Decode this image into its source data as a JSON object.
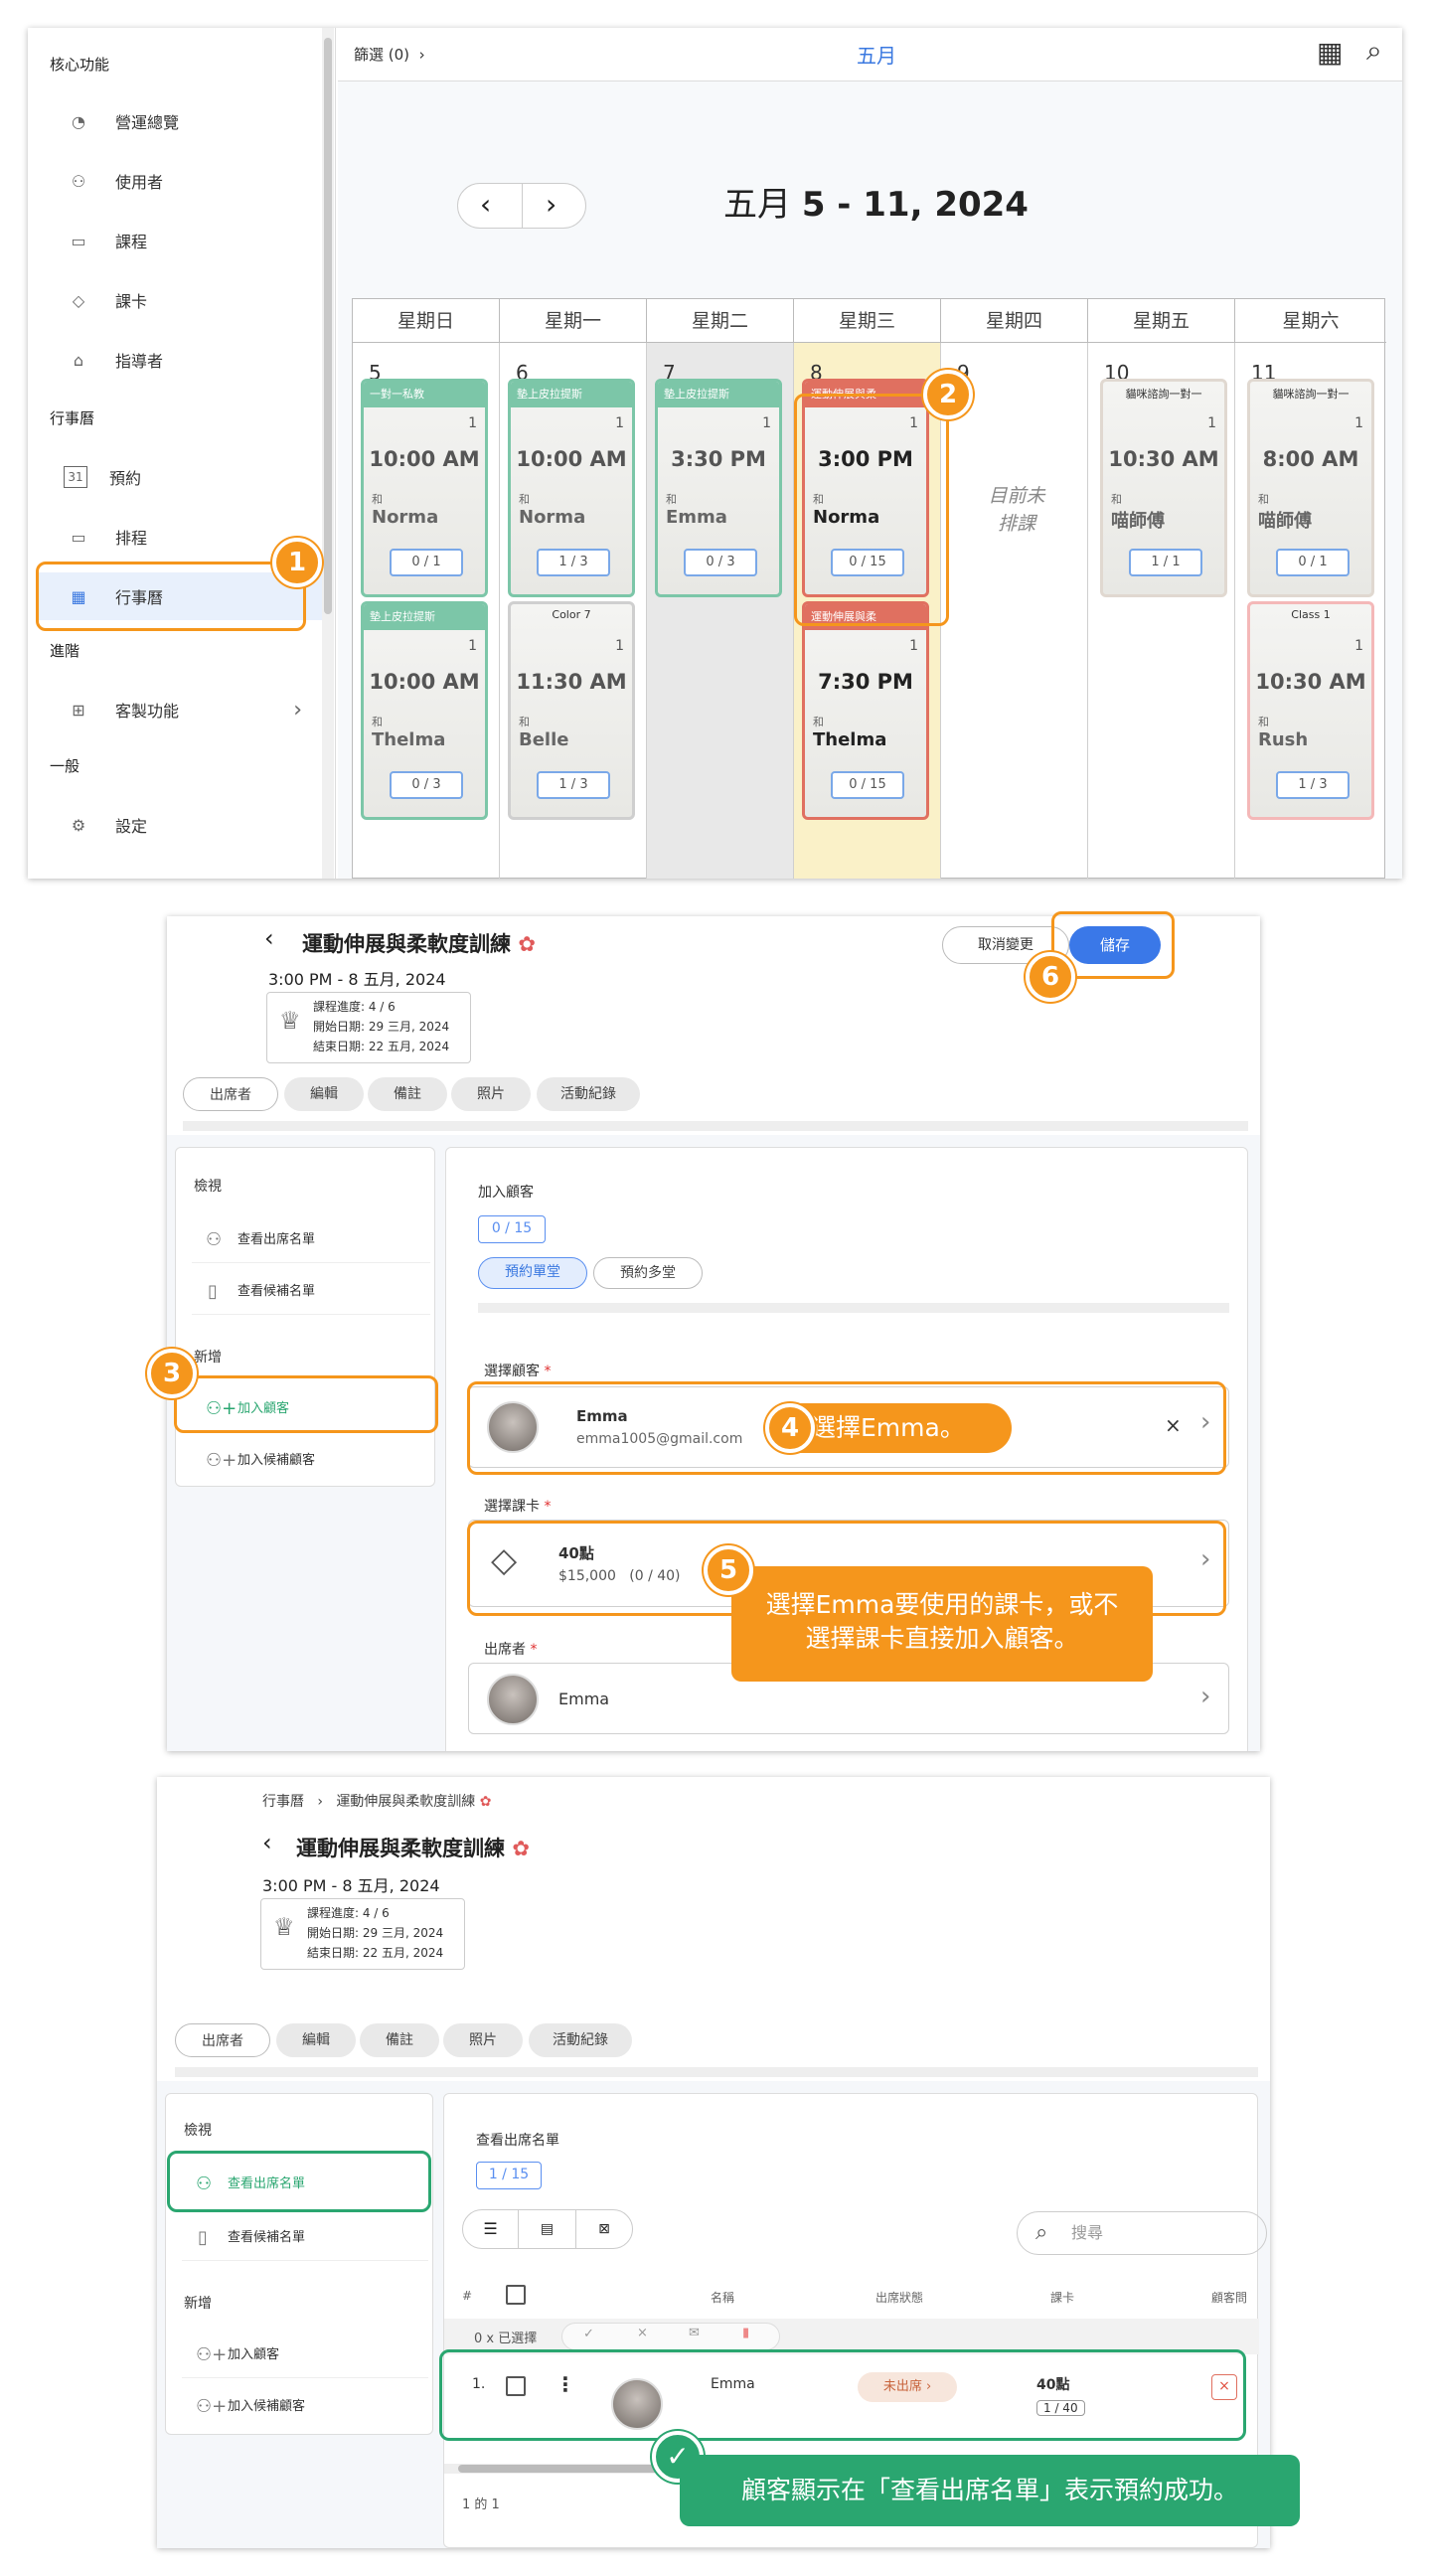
{
  "calendar": {
    "filter": "篩選 (0)",
    "month": "五月",
    "range_prefix": "五月 ",
    "range_bold": "5 - 11, 2024",
    "days": [
      "星期日",
      "星期一",
      "星期二",
      "星期三",
      "星期四",
      "星期五",
      "星期六"
    ],
    "dates": [
      "5",
      "6",
      "7",
      "8",
      "9",
      "10",
      "11"
    ],
    "no_class": "目前未排課",
    "cards": [
      {
        "title": "一對一私教",
        "cap": "1",
        "time": "10:00 AM",
        "with": "和",
        "teacher": "Norma",
        "spots": "0 / 1",
        "color": "#7cc6a8"
      },
      {
        "title": "墊上皮拉提斯",
        "cap": "1",
        "time": "10:00 AM",
        "with": "和",
        "teacher": "Norma",
        "spots": "1 / 3",
        "color": "#7cc6a8"
      },
      {
        "title": "墊上皮拉提斯",
        "cap": "1",
        "time": "3:30 PM",
        "with": "和",
        "teacher": "Emma",
        "spots": "0 / 3",
        "color": "#7cc6a8"
      },
      {
        "title": "運動伸展與柔",
        "cap": "1",
        "time": "3:00 PM",
        "with": "和",
        "teacher": "Norma",
        "spots": "0 / 15",
        "color": "#e07060"
      },
      {
        "title": "貓咪諮詢一對一",
        "cap": "1",
        "time": "10:30 AM",
        "with": "和",
        "teacher": "喵師傅",
        "spots": "1 / 1",
        "color": "#e0d8d0"
      },
      {
        "title": "貓咪諮詢一對一",
        "cap": "1",
        "time": "8:00 AM",
        "with": "和",
        "teacher": "喵師傅",
        "spots": "0 / 1",
        "color": "#e0d8d0"
      },
      {
        "title": "墊上皮拉提斯",
        "cap": "1",
        "time": "10:00 AM",
        "with": "和",
        "teacher": "Thelma",
        "spots": "0 / 3",
        "color": "#7cc6a8"
      },
      {
        "title": "Color 7",
        "cap": "1",
        "time": "11:30 AM",
        "with": "和",
        "teacher": "Belle",
        "spots": "1 / 3",
        "color": "#e5e5e5"
      },
      {
        "title": "運動伸展與柔",
        "cap": "1",
        "time": "7:30 PM",
        "with": "和",
        "teacher": "Thelma",
        "spots": "0 / 15",
        "color": "#e07060"
      },
      {
        "title": "Class 1",
        "cap": "1",
        "time": "10:30 AM",
        "with": "和",
        "teacher": "Rush",
        "spots": "1 / 3",
        "color": "#f4b8b8"
      }
    ]
  },
  "sidebar": {
    "cat1": "核心功能",
    "items1": [
      "營運總覽",
      "使用者",
      "課程",
      "課卡",
      "指導者"
    ],
    "cat2": "行事曆",
    "items2": [
      "預約",
      "排程",
      "行事曆"
    ],
    "cat3": "進階",
    "items3": [
      "客製功能"
    ],
    "cat4": "一般",
    "items4": [
      "設定"
    ]
  },
  "steps": [
    "1",
    "2",
    "3",
    "4",
    "5",
    "6"
  ],
  "detail": {
    "title": "運動伸展與柔軟度訓練",
    "datetime": "3:00 PM - 8 五月, 2024",
    "progress": "課程進度: 4 / 6",
    "start": "開始日期: 29 三月, 2024",
    "end": "結束日期: 22 五月, 2024",
    "tabs": [
      "出席者",
      "編輯",
      "備註",
      "照片",
      "活動紀錄"
    ],
    "cancel": "取消變更",
    "save": "儲存",
    "view_head": "檢視",
    "view_items": [
      "查看出席名單",
      "查看候補名單"
    ],
    "new_head": "新增",
    "new_items": [
      "加入顧客",
      "加入候補顧客"
    ],
    "add_customer": "加入顧客",
    "count": "0 / 15",
    "book_single": "預約單堂",
    "book_multi": "預約多堂",
    "select_customer": "選擇顧客",
    "customer_name": "Emma",
    "customer_email": "emma1005@gmail.com",
    "select_card": "選擇課卡",
    "card_name": "40點",
    "card_price": "$15,000   (0 / 40)",
    "attendee_label": "出席者",
    "attendee": "Emma",
    "tip4": "選擇Emma。",
    "tip5": "選擇Emma要使用的課卡，或不選擇課卡直接加入顧客。"
  },
  "result": {
    "crumb1": "行事曆",
    "crumb2": "運動伸展與柔軟度訓練",
    "list_title": "查看出席名單",
    "count": "1 / 15",
    "search_placeholder": "搜尋",
    "cols": [
      "#",
      "名稱",
      "出席狀態",
      "課卡",
      "顧客問"
    ],
    "selected": "0 x 已選擇",
    "row_num": "1.",
    "row_name": "Emma",
    "row_status": "未出席",
    "row_card": "40點",
    "row_card_count": "1 / 40",
    "footer": "1 的 1",
    "tip": "顧客顯示在「查看出席名單」表示預約成功。"
  }
}
